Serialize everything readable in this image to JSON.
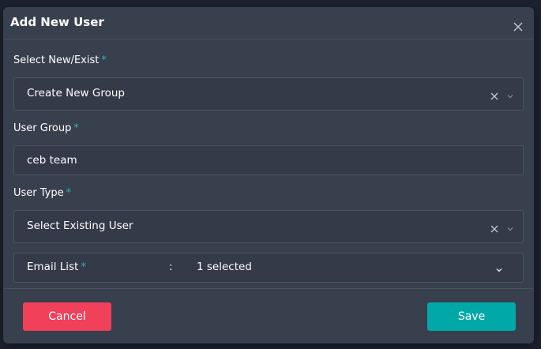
{
  "dialog": {
    "title": "Add New User"
  },
  "fields": {
    "select_new_exist": {
      "label": "Select New/Exist",
      "required_mark": "*",
      "value": "Create New Group"
    },
    "user_group": {
      "label": "User Group",
      "required_mark": "*",
      "value": "ceb team"
    },
    "user_type": {
      "label": "User Type",
      "required_mark": "*",
      "value": "Select Existing User"
    },
    "email_list": {
      "label": "Email List",
      "required_mark": "*",
      "separator": ":",
      "value": "1 selected"
    }
  },
  "footer": {
    "cancel_label": "Cancel",
    "save_label": "Save"
  },
  "colors": {
    "accent": "#00a8a8",
    "danger": "#f0405a",
    "required": "#2fb4b4"
  },
  "icons": {
    "close": "close-icon",
    "clear": "clear-icon",
    "chevron": "chevron-down-icon"
  }
}
